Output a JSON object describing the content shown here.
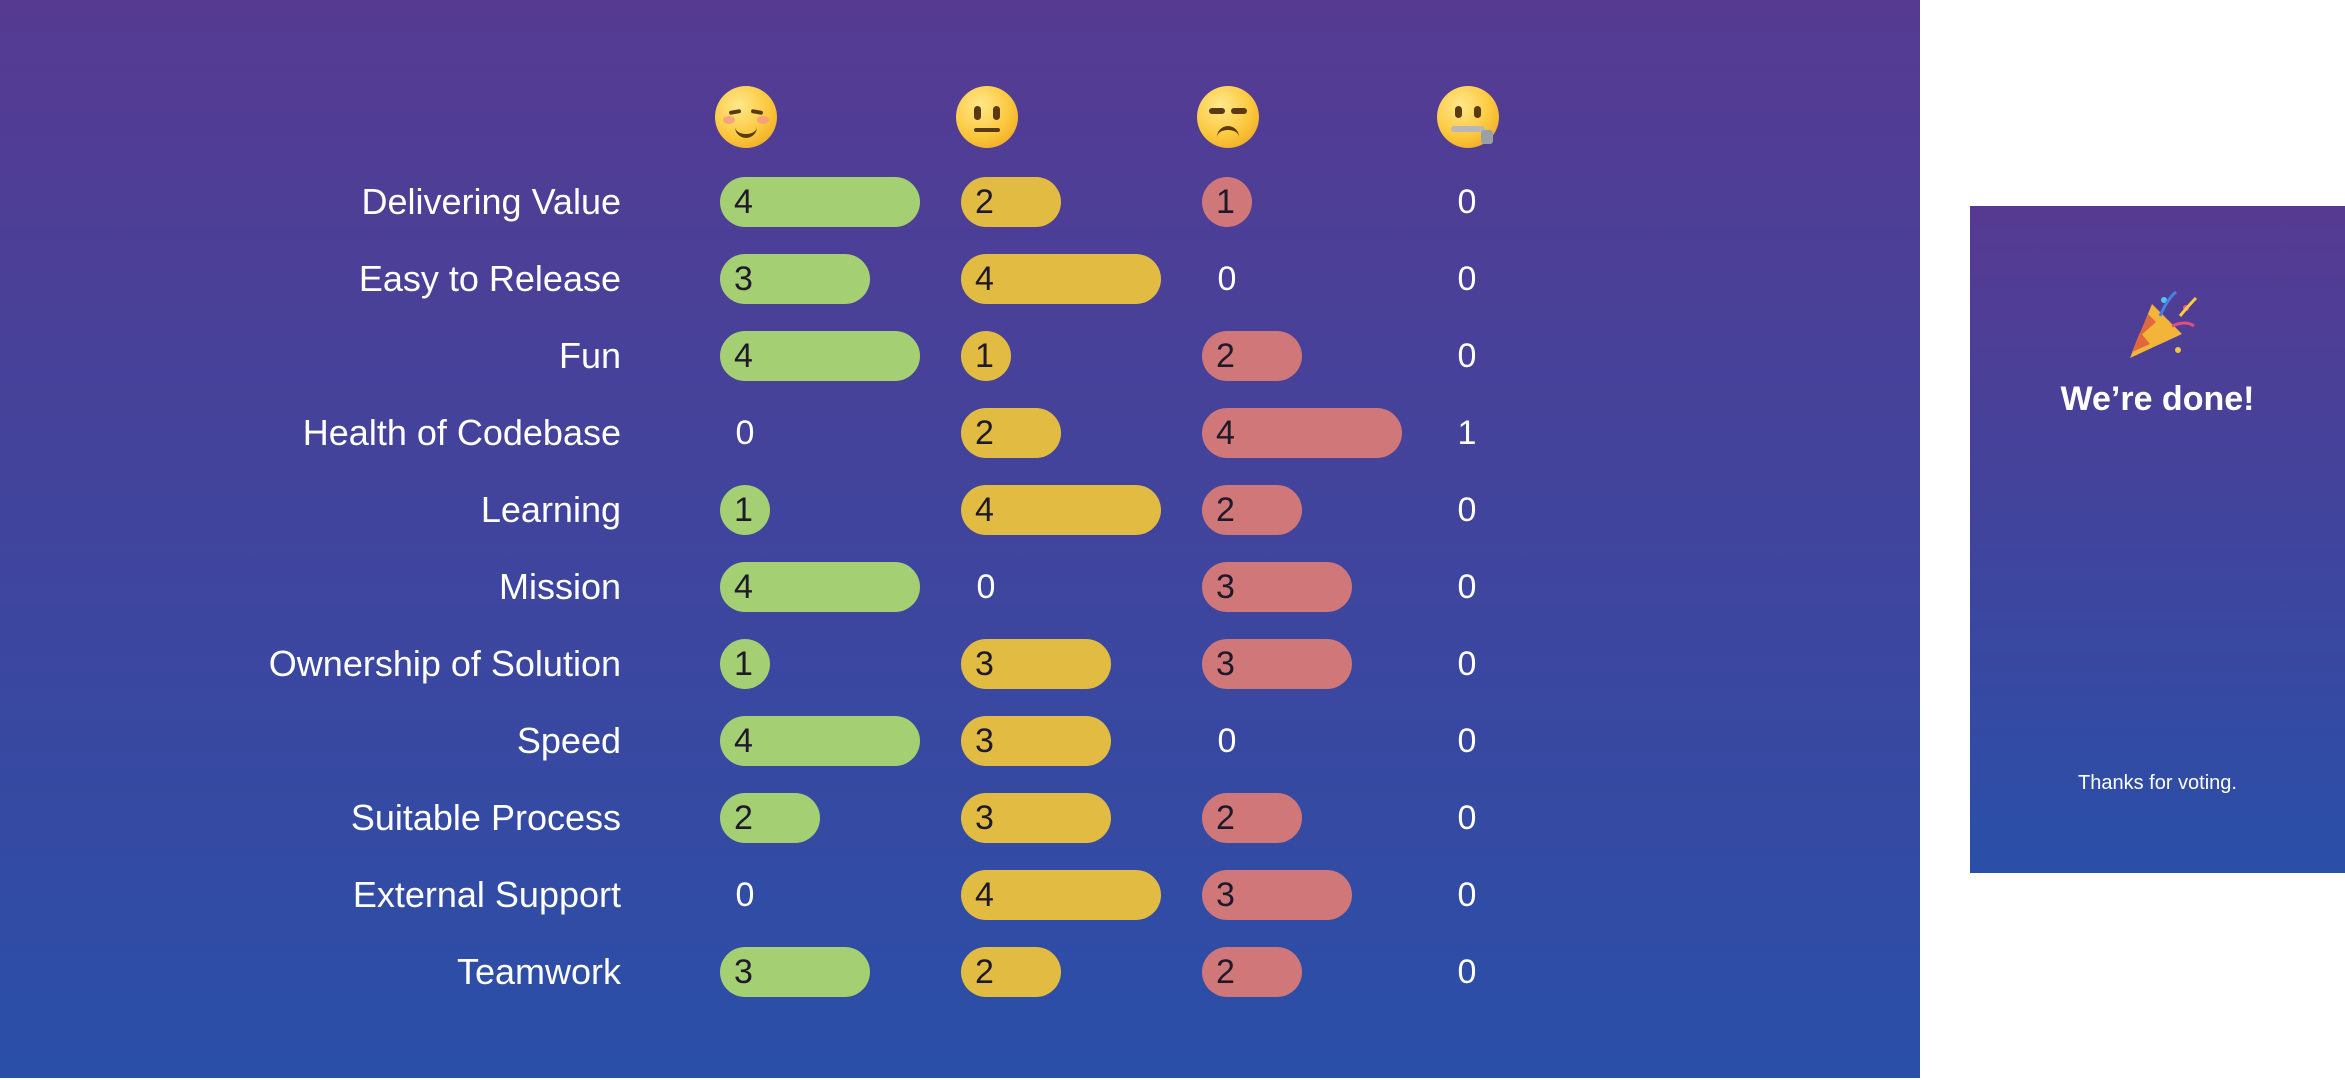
{
  "colors": {
    "happy": "#a4cf72",
    "neutral": "#e2bc42",
    "unhappy": "#d0777a",
    "background_top": "#563a92",
    "background_bottom": "#2a4fa8"
  },
  "columns": [
    {
      "key": "happy",
      "icon": "smiling-blush-emoji-icon"
    },
    {
      "key": "neutral",
      "icon": "neutral-face-emoji-icon"
    },
    {
      "key": "unhappy",
      "icon": "unamused-face-emoji-icon"
    },
    {
      "key": "zipped",
      "icon": "zipper-mouth-emoji-icon"
    }
  ],
  "rows": [
    {
      "label": "Delivering Value",
      "happy": "4",
      "neutral": "2",
      "unhappy": "1",
      "zipped": "0"
    },
    {
      "label": "Easy to Release",
      "happy": "3",
      "neutral": "4",
      "unhappy": "0",
      "zipped": "0"
    },
    {
      "label": "Fun",
      "happy": "4",
      "neutral": "1",
      "unhappy": "2",
      "zipped": "0"
    },
    {
      "label": "Health of Codebase",
      "happy": "0",
      "neutral": "2",
      "unhappy": "4",
      "zipped": "1"
    },
    {
      "label": "Learning",
      "happy": "1",
      "neutral": "4",
      "unhappy": "2",
      "zipped": "0"
    },
    {
      "label": "Mission",
      "happy": "4",
      "neutral": "0",
      "unhappy": "3",
      "zipped": "0"
    },
    {
      "label": "Ownership of Solution",
      "happy": "1",
      "neutral": "3",
      "unhappy": "3",
      "zipped": "0"
    },
    {
      "label": "Speed",
      "happy": "4",
      "neutral": "3",
      "unhappy": "0",
      "zipped": "0"
    },
    {
      "label": "Suitable Process",
      "happy": "2",
      "neutral": "3",
      "unhappy": "2",
      "zipped": "0"
    },
    {
      "label": "External Support",
      "happy": "0",
      "neutral": "4",
      "unhappy": "3",
      "zipped": "0"
    },
    {
      "label": "Teamwork",
      "happy": "3",
      "neutral": "2",
      "unhappy": "2",
      "zipped": "0"
    }
  ],
  "done_card": {
    "icon": "party-popper-icon",
    "title": "We’re done!",
    "subtitle": "Thanks for voting."
  }
}
